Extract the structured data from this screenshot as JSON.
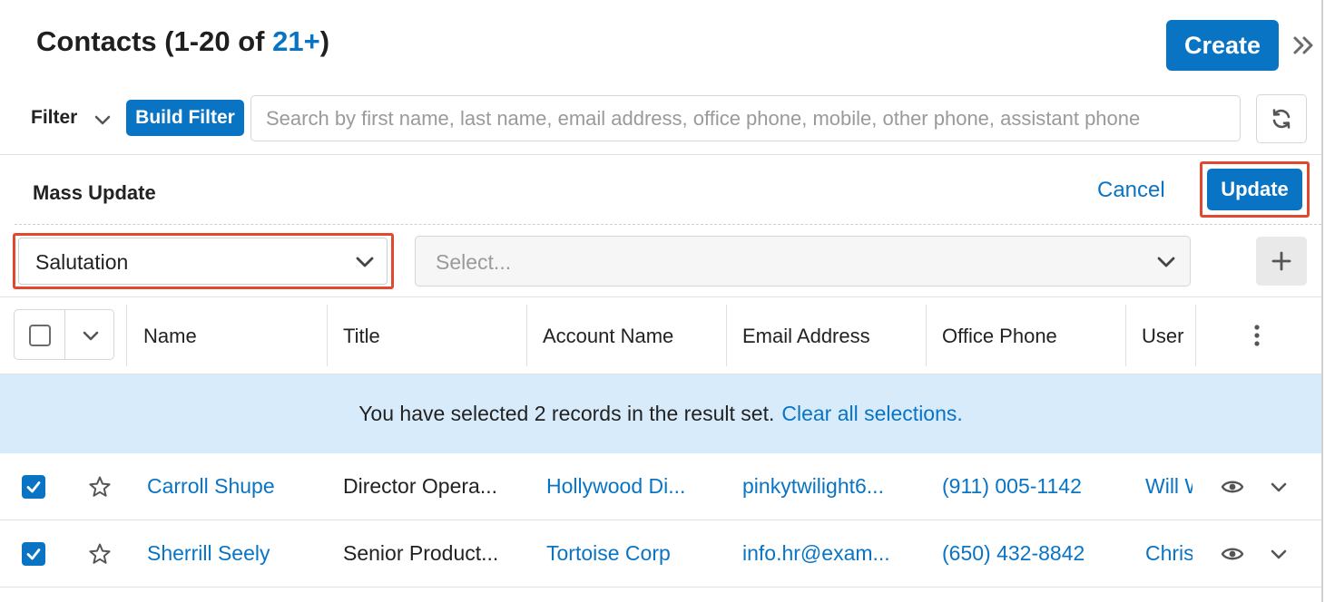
{
  "header": {
    "title_prefix": "Contacts (1-20 of ",
    "title_count_link": "21+",
    "title_suffix": ")",
    "create_label": "Create"
  },
  "filter": {
    "label": "Filter",
    "build_filter_label": "Build Filter",
    "search_placeholder": "Search by first name, last name, email address, office phone, mobile, other phone, assistant phone"
  },
  "mass_update": {
    "title": "Mass Update",
    "cancel_label": "Cancel",
    "update_label": "Update",
    "field_value": "Salutation",
    "value_placeholder": "Select..."
  },
  "table": {
    "columns": [
      "Name",
      "Title",
      "Account Name",
      "Email Address",
      "Office Phone",
      "User"
    ],
    "banner_text": "You have selected 2 records in the result set.",
    "banner_link": "Clear all selections.",
    "rows": [
      {
        "name": "Carroll Shupe",
        "title": "Director Opera...",
        "account": "Hollywood Di...",
        "email": "pinkytwilight6...",
        "phone": "(911) 005-1142",
        "user": "Will Westin",
        "checked": true
      },
      {
        "name": "Sherrill Seely",
        "title": "Senior Product...",
        "account": "Tortoise Corp",
        "email": "info.hr@exam...",
        "phone": "(650) 432-8842",
        "user": "Chris Olliver",
        "checked": true
      }
    ]
  },
  "colors": {
    "accent": "#0a74c4",
    "highlight": "#e0492f",
    "banner_bg": "#d8ebfb"
  },
  "icons": [
    "chevron-right-double-icon",
    "chevron-down-icon",
    "refresh-icon",
    "plus-icon",
    "kebab-icon",
    "star-icon",
    "eye-icon",
    "checkmark-icon"
  ]
}
